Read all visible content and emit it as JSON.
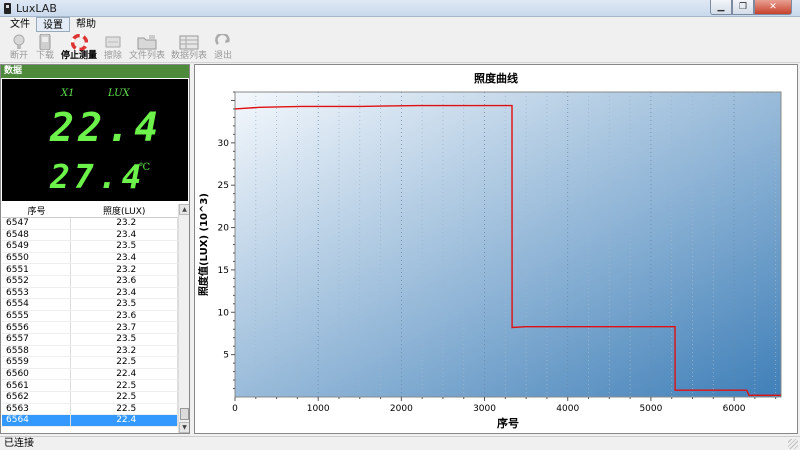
{
  "window": {
    "title": "LuxLAB"
  },
  "menu": [
    "文件",
    "设置",
    "帮助"
  ],
  "toolbar": [
    {
      "label": "断开",
      "icon": "lightbulb-icon",
      "enabled": false
    },
    {
      "label": "下载",
      "icon": "phone-icon",
      "enabled": false
    },
    {
      "label": "停止测量",
      "icon": "lifebuoy-icon",
      "enabled": true
    },
    {
      "label": "擦除",
      "icon": "eraser-icon",
      "enabled": false
    },
    {
      "label": "文件列表",
      "icon": "folder-icon",
      "enabled": false
    },
    {
      "label": "数据列表",
      "icon": "table-icon",
      "enabled": false
    },
    {
      "label": "退出",
      "icon": "exit-icon",
      "enabled": false
    }
  ],
  "panel": {
    "header": "数据"
  },
  "display": {
    "label_x": "X1",
    "label_unit": "LUX",
    "lux_value": "22.4",
    "temp_value": "27.4",
    "temp_unit": "℃"
  },
  "table": {
    "columns": [
      "序号",
      "照度(LUX)"
    ],
    "rows": [
      [
        "6547",
        "23.2"
      ],
      [
        "6548",
        "23.4"
      ],
      [
        "6549",
        "23.5"
      ],
      [
        "6550",
        "23.4"
      ],
      [
        "6551",
        "23.2"
      ],
      [
        "6552",
        "23.6"
      ],
      [
        "6553",
        "23.4"
      ],
      [
        "6554",
        "23.5"
      ],
      [
        "6555",
        "23.6"
      ],
      [
        "6556",
        "23.7"
      ],
      [
        "6557",
        "23.5"
      ],
      [
        "6558",
        "23.2"
      ],
      [
        "6559",
        "22.5"
      ],
      [
        "6560",
        "22.4"
      ],
      [
        "6561",
        "22.5"
      ],
      [
        "6562",
        "22.5"
      ],
      [
        "6563",
        "22.5"
      ],
      [
        "6564",
        "22.4"
      ]
    ],
    "selected_index": 17
  },
  "chart_data": {
    "type": "line",
    "title": "照度曲线",
    "xlabel": "序号",
    "ylabel": "照度值(LUX) (10^3)",
    "xlim": [
      0,
      6564
    ],
    "ylim": [
      0,
      36
    ],
    "xticks": [
      0,
      1000,
      2000,
      3000,
      4000,
      5000,
      6000
    ],
    "yticks": [
      5,
      10,
      15,
      20,
      25,
      30
    ],
    "grid": "vertical dotted",
    "colors": {
      "line": "#e01010",
      "bg_start": "#f4f8fc",
      "bg_end": "#3f7fb8"
    },
    "series": [
      {
        "x": [
          0,
          300,
          800,
          1500,
          2200,
          2900,
          3300,
          3330,
          3331,
          3500,
          3800,
          4500,
          5250,
          5290,
          5291,
          5600,
          6150,
          6180,
          6564
        ],
        "values": [
          34.0,
          34.2,
          34.3,
          34.3,
          34.4,
          34.4,
          34.4,
          34.4,
          8.2,
          8.3,
          8.3,
          8.3,
          8.3,
          8.3,
          0.8,
          0.8,
          0.8,
          0.2,
          0.2
        ]
      }
    ]
  },
  "status": {
    "text": "已连接"
  }
}
